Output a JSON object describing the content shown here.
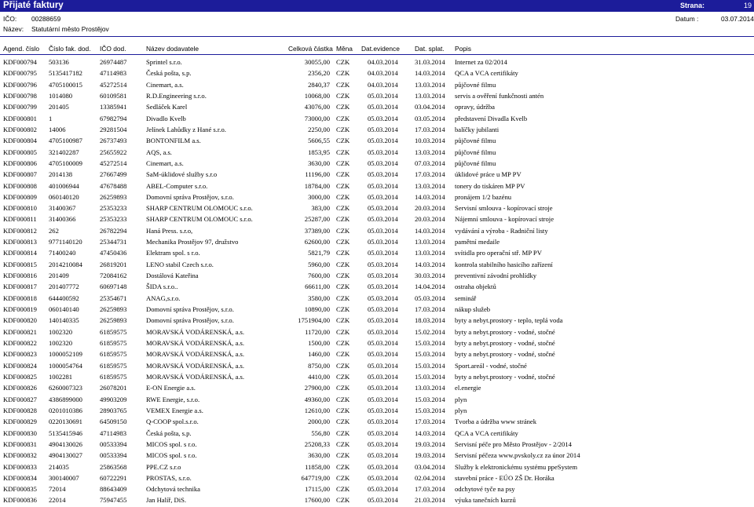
{
  "header": {
    "title": "Přijaté faktury",
    "page_label": "Strana:",
    "page_number": "19",
    "ico_label": "IČO:",
    "ico_value": "00288659",
    "name_label": "Název:",
    "name_value": "Statutární město Prostějov",
    "date_label": "Datum :",
    "date_value": "03.07.2014"
  },
  "columns": [
    "Agend. číslo",
    "Číslo fak. dod.",
    "IČO dod.",
    "Název dodavatele",
    "Celková částka",
    "Měna",
    "Dat.evidence",
    "Dat. splat.",
    "Popis"
  ],
  "rows": [
    [
      "KDF000794",
      "503136",
      "26974487",
      "Sprintel s.r.o.",
      "30055,00",
      "CZK",
      "04.03.2014",
      "31.03.2014",
      "Internet za 02/2014"
    ],
    [
      "KDF000795",
      "5135417182",
      "47114983",
      "Česká pošta, s.p.",
      "2356,20",
      "CZK",
      "04.03.2014",
      "14.03.2014",
      "QCA a VCA certifikáty"
    ],
    [
      "KDF000796",
      "4705100015",
      "45272514",
      "Cinemart, a.s.",
      "2840,37",
      "CZK",
      "04.03.2014",
      "13.03.2014",
      "půjčovné filmu"
    ],
    [
      "KDF000798",
      "1014080",
      "60109581",
      "R.D.Engineering s.r.o.",
      "10068,00",
      "CZK",
      "05.03.2014",
      "13.03.2014",
      "servis a ověření funkčnosti antén"
    ],
    [
      "KDF000799",
      "201405",
      "13385941",
      "Sedláček Karel",
      "43076,00",
      "CZK",
      "05.03.2014",
      "03.04.2014",
      "opravy, údržba"
    ],
    [
      "KDF000801",
      "1",
      "67982794",
      "Divadlo Kvelb",
      "73000,00",
      "CZK",
      "05.03.2014",
      "03.05.2014",
      "představení Divadla Kvelb"
    ],
    [
      "KDF000802",
      "14006",
      "29281504",
      "Jelínek Lahůdky z Hané s.r.o.",
      "2250,00",
      "CZK",
      "05.03.2014",
      "17.03.2014",
      "balíčky jubilanti"
    ],
    [
      "KDF000804",
      "4705100987",
      "26737493",
      "BONTONFILM a.s.",
      "5606,55",
      "CZK",
      "05.03.2014",
      "10.03.2014",
      "půjčovné filmu"
    ],
    [
      "KDF000805",
      "321402287",
      "25655922",
      "AQS, a.s.",
      "1853,95",
      "CZK",
      "05.03.2014",
      "13.03.2014",
      "půjčovné filmu"
    ],
    [
      "KDF000806",
      "4705100009",
      "45272514",
      "Cinemart, a.s.",
      "3630,00",
      "CZK",
      "05.03.2014",
      "07.03.2014",
      "půjčovné filmu"
    ],
    [
      "KDF000807",
      "2014138",
      "27667499",
      "SaM-úklidové služby s.r.o",
      "11196,00",
      "CZK",
      "05.03.2014",
      "17.03.2014",
      "úklidové práce u MP PV"
    ],
    [
      "KDF000808",
      "401006944",
      "47678488",
      "ABEL-Computer s.r.o.",
      "18784,00",
      "CZK",
      "05.03.2014",
      "13.03.2014",
      "tonery do tiskáren MP PV"
    ],
    [
      "KDF000809",
      "060140120",
      "26259893",
      "Domovní správa Prostějov, s.r.o.",
      "3000,00",
      "CZK",
      "05.03.2014",
      "14.03.2014",
      "pronájem 1/2 bazénu"
    ],
    [
      "KDF000810",
      "31400367",
      "25353233",
      "SHARP CENTRUM OLOMOUC s.r.o.",
      "383,00",
      "CZK",
      "05.03.2014",
      "20.03.2014",
      "Servisní smlouva - kopírovací stroje"
    ],
    [
      "KDF000811",
      "31400366",
      "25353233",
      "SHARP CENTRUM OLOMOUC s.r.o.",
      "25287,00",
      "CZK",
      "05.03.2014",
      "20.03.2014",
      "Nájemní smlouva - kopírovací stroje"
    ],
    [
      "KDF000812",
      "262",
      "26782294",
      "Haná Press. s.r.o,",
      "37389,00",
      "CZK",
      "05.03.2014",
      "14.03.2014",
      "vydávání a výroba - Radniční listy"
    ],
    [
      "KDF000813",
      "9771140120",
      "25344731",
      "Mechanika Prostějov 97, družstvo",
      "62600,00",
      "CZK",
      "05.03.2014",
      "13.03.2014",
      "pamětní medaile"
    ],
    [
      "KDF000814",
      "71400240",
      "47450436",
      "Elektram spol. s r.o.",
      "5821,79",
      "CZK",
      "05.03.2014",
      "13.03.2014",
      "svítidla pro operační stř. MP PV"
    ],
    [
      "KDF000815",
      "2014210084",
      "26819201",
      "LENO stabil Czech s.r.o.",
      "5960,00",
      "CZK",
      "05.03.2014",
      "14.03.2014",
      "kontrola stabilního hasicího zařízení"
    ],
    [
      "KDF000816",
      "201409",
      "72084162",
      "Dostálová Kateřina",
      "7600,00",
      "CZK",
      "05.03.2014",
      "30.03.2014",
      "preventivní závodní prohlídky"
    ],
    [
      "KDF000817",
      "201407772",
      "60697148",
      "ŠIDA s.r.o..",
      "66611,00",
      "CZK",
      "05.03.2014",
      "14.04.2014",
      "ostraha objektů"
    ],
    [
      "KDF000818",
      "644400592",
      "25354671",
      "ANAG,s.r.o.",
      "3580,00",
      "CZK",
      "05.03.2014",
      "05.03.2014",
      "seminář"
    ],
    [
      "KDF000819",
      "060140140",
      "26259893",
      "Domovní správa Prostějov, s.r.o.",
      "10890,00",
      "CZK",
      "05.03.2014",
      "17.03.2014",
      "nákup služeb"
    ],
    [
      "KDF000820",
      "140140335",
      "26259893",
      "Domovní správa Prostějov, s.r.o.",
      "1751904,00",
      "CZK",
      "05.03.2014",
      "18.03.2014",
      "byty a nebyt.prostory - teplo, teplá voda"
    ],
    [
      "KDF000821",
      "1002320",
      "61859575",
      "MORAVSKÁ VODÁRENSKÁ, a.s.",
      "11720,00",
      "CZK",
      "05.03.2014",
      "15.02.2014",
      "byty a nebyt.prostory - vodné, stočné"
    ],
    [
      "KDF000822",
      "1002320",
      "61859575",
      "MORAVSKÁ VODÁRENSKÁ, a.s.",
      "1500,00",
      "CZK",
      "05.03.2014",
      "15.03.2014",
      "byty a nebyt.prostory - vodné, stočné"
    ],
    [
      "KDF000823",
      "1000052109",
      "61859575",
      "MORAVSKÁ VODÁRENSKÁ, a.s.",
      "1460,00",
      "CZK",
      "05.03.2014",
      "15.03.2014",
      "byty a nebyt.prostory - vodné, stočné"
    ],
    [
      "KDF000824",
      "1000054764",
      "61859575",
      "MORAVSKÁ VODÁRENSKÁ, a.s.",
      "8750,00",
      "CZK",
      "05.03.2014",
      "15.03.2014",
      "Sport.areál - vodné, stočné"
    ],
    [
      "KDF000825",
      "1002281",
      "61859575",
      "MORAVSKÁ VODÁRENSKÁ, a.s.",
      "4410,00",
      "CZK",
      "05.03.2014",
      "15.03.2014",
      "byty a nebyt.prostory - vodné, stočné"
    ],
    [
      "KDF000826",
      "6260007323",
      "26078201",
      "E-ON Energie a.s.",
      "27900,00",
      "CZK",
      "05.03.2014",
      "13.03.2014",
      "el.energie"
    ],
    [
      "KDF000827",
      "4386899000",
      "49903209",
      "RWE Energie, s.r.o.",
      "49360,00",
      "CZK",
      "05.03.2014",
      "15.03.2014",
      "plyn"
    ],
    [
      "KDF000828",
      "0201010386",
      "28903765",
      "VEMEX Energie a.s.",
      "12610,00",
      "CZK",
      "05.03.2014",
      "15.03.2014",
      "plyn"
    ],
    [
      "KDF000829",
      "0220130691",
      "64509150",
      "Q-COOP spol.s.r.o.",
      "2000,00",
      "CZK",
      "05.03.2014",
      "17.03.2014",
      "Tvorba a údržba www stránek"
    ],
    [
      "KDF000830",
      "5135415946",
      "47114983",
      "Česká pošta, s.p.",
      "556,80",
      "CZK",
      "05.03.2014",
      "14.03.2014",
      "QCA a VCA certifikáty"
    ],
    [
      "KDF000831",
      "4904130026",
      "00533394",
      "MICOS spol. s r.o.",
      "25208,33",
      "CZK",
      "05.03.2014",
      "19.03.2014",
      "Servisní péče pro Město Prostějov - 2/2014"
    ],
    [
      "KDF000832",
      "4904130027",
      "00533394",
      "MICOS spol. s r.o.",
      "3630,00",
      "CZK",
      "05.03.2014",
      "19.03.2014",
      "Servisní péčeza www.pvskoly.cz za únor 2014"
    ],
    [
      "KDF000833",
      "214035",
      "25863568",
      "PPE.CZ s.r.o",
      "11858,00",
      "CZK",
      "05.03.2014",
      "03.04.2014",
      "Služby k elektronickému systému ppeSystem"
    ],
    [
      "KDF000834",
      "300140007",
      "60722291",
      "PROSTAS, s.r.o.",
      "647719,00",
      "CZK",
      "05.03.2014",
      "02.04.2014",
      "stavební práce - EÚO ZŠ Dr. Horáka"
    ],
    [
      "KDF000835",
      "72014",
      "88643409",
      "Odchytová technika",
      "17115,00",
      "CZK",
      "05.03.2014",
      "17.03.2014",
      "odchytové tyče na psy"
    ],
    [
      "KDF000836",
      "22014",
      "75947455",
      "Jan Halíř, DiS.",
      "17600,00",
      "CZK",
      "05.03.2014",
      "21.03.2014",
      "výuka tanečních kurzů"
    ]
  ]
}
